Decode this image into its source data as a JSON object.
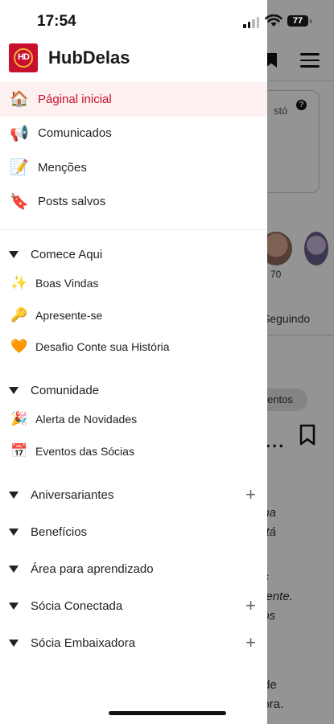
{
  "status_bar": {
    "time": "17:54",
    "battery": "77"
  },
  "brand": {
    "name": "HubDelas",
    "logo_text": "HD"
  },
  "nav": [
    {
      "label": "Páginal inicial",
      "icon": "house-icon",
      "active": true
    },
    {
      "label": "Comunicados",
      "icon": "megaphone-icon",
      "active": false
    },
    {
      "label": "Menções",
      "icon": "memo-icon",
      "active": false
    },
    {
      "label": "Posts salvos",
      "icon": "bookmark-ribbon-icon",
      "active": false
    }
  ],
  "sections": [
    {
      "label": "Comece Aqui",
      "expanded": true,
      "has_add": false,
      "items": [
        {
          "label": "Boas Vindas",
          "icon": "sparkle-icon"
        },
        {
          "label": "Apresente-se",
          "icon": "key-icon"
        },
        {
          "label": "Desafio Conte sua História",
          "icon": "orange-heart-icon"
        }
      ]
    },
    {
      "label": "Comunidade",
      "expanded": true,
      "has_add": false,
      "items": [
        {
          "label": "Alerta de Novidades",
          "icon": "party-popper-icon"
        },
        {
          "label": "Eventos das Sócias",
          "icon": "calendar-people-icon"
        }
      ]
    },
    {
      "label": "Aniversariantes",
      "expanded": false,
      "has_add": true,
      "items": []
    },
    {
      "label": "Benefícios",
      "expanded": false,
      "has_add": false,
      "items": []
    },
    {
      "label": "Área para aprendizado",
      "expanded": false,
      "has_add": false,
      "items": []
    },
    {
      "label": "Sócia Conectada",
      "expanded": false,
      "has_add": true,
      "items": []
    },
    {
      "label": "Sócia Embaixadora",
      "expanded": false,
      "has_add": true,
      "items": []
    }
  ],
  "background": {
    "card_text": "stó",
    "follower_count": "70",
    "tab_label": "Seguindo",
    "pill_label": "entos",
    "post_ellipsis": "...",
    "post_lines": [
      "nha",
      "e tá",
      "as",
      "mente.",
      "nos",
      "r de",
      "dora."
    ]
  },
  "colors": {
    "brand": "#c8102e",
    "logo_ring": "#f5b335",
    "active_bg": "#fdf0f0"
  }
}
